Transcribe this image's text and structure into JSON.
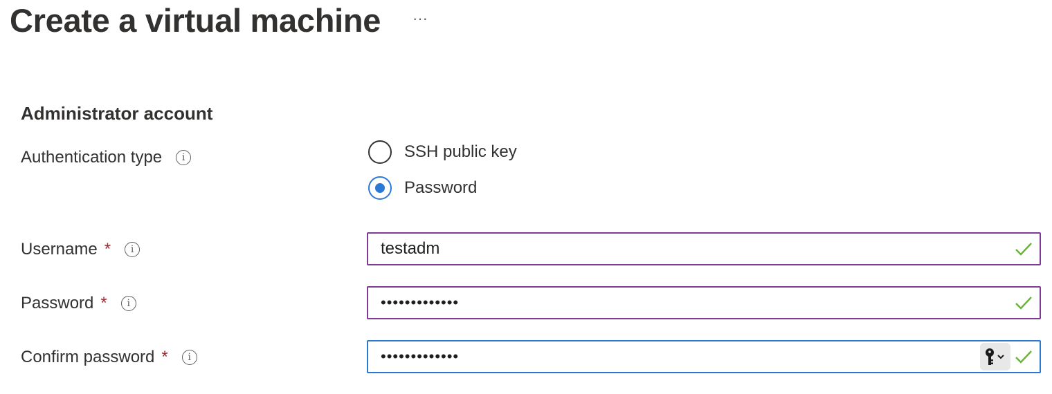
{
  "header": {
    "title": "Create a virtual machine",
    "more_label": "···"
  },
  "section": {
    "title": "Administrator account"
  },
  "auth_type": {
    "label": "Authentication type",
    "options": [
      {
        "label": "SSH public key",
        "selected": false
      },
      {
        "label": "Password",
        "selected": true
      }
    ]
  },
  "username": {
    "label": "Username",
    "required_mark": "*",
    "value": "testadm",
    "valid": true
  },
  "password": {
    "label": "Password",
    "required_mark": "*",
    "value": "•••••••••••••",
    "valid": true
  },
  "confirm_password": {
    "label": "Confirm password",
    "required_mark": "*",
    "value": "•••••••••••••",
    "valid": true,
    "focused": true
  },
  "icons": {
    "info": "info-icon",
    "check": "checkmark-icon",
    "key": "key-icon",
    "chevron": "chevron-down-icon"
  },
  "colors": {
    "accent_blue": "#2b78d4",
    "input_border": "#7f3a93",
    "required_red": "#a4262c",
    "valid_green": "#6bb13a"
  },
  "info_glyph": "i"
}
